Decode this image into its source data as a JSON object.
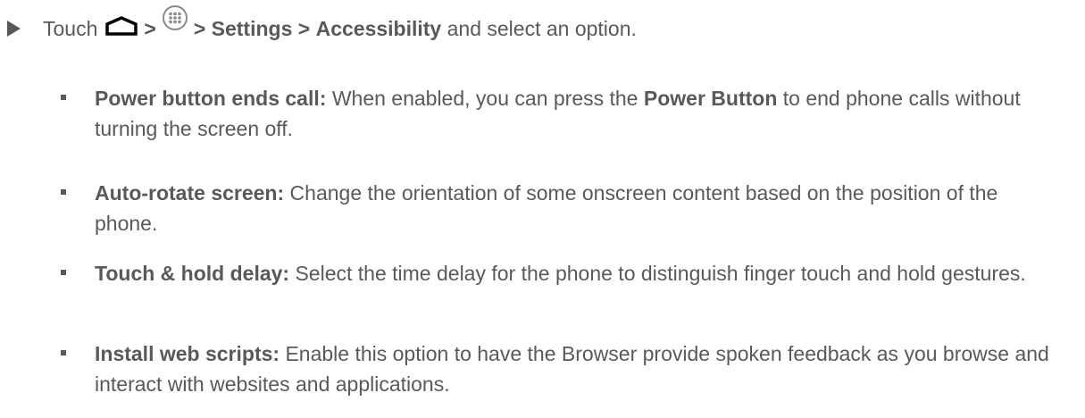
{
  "step": {
    "prefix": "Touch",
    "sep1": ">",
    "sep2": ">",
    "settings": "Settings",
    "sep3": ">",
    "accessibility": "Accessibility",
    "suffix": "and select an option.",
    "icons": [
      "home-icon",
      "apps-icon"
    ]
  },
  "options": [
    {
      "term": "Power button ends call:",
      "text_a": "When enabled, you can press the",
      "bold": "Power Button",
      "text_b": "to end phone calls without turning the screen off."
    },
    {
      "term": "Auto-rotate screen:",
      "text": "Change the orientation of some onscreen content based on the position of the phone."
    },
    {
      "term": "Touch & hold delay:",
      "text": "Select the time delay for the phone to distinguish finger touch and hold gestures."
    },
    {
      "term": "Install web scripts:",
      "text": "Enable this option to have the Browser provide spoken feedback as you browse and interact with websites and applications."
    }
  ]
}
